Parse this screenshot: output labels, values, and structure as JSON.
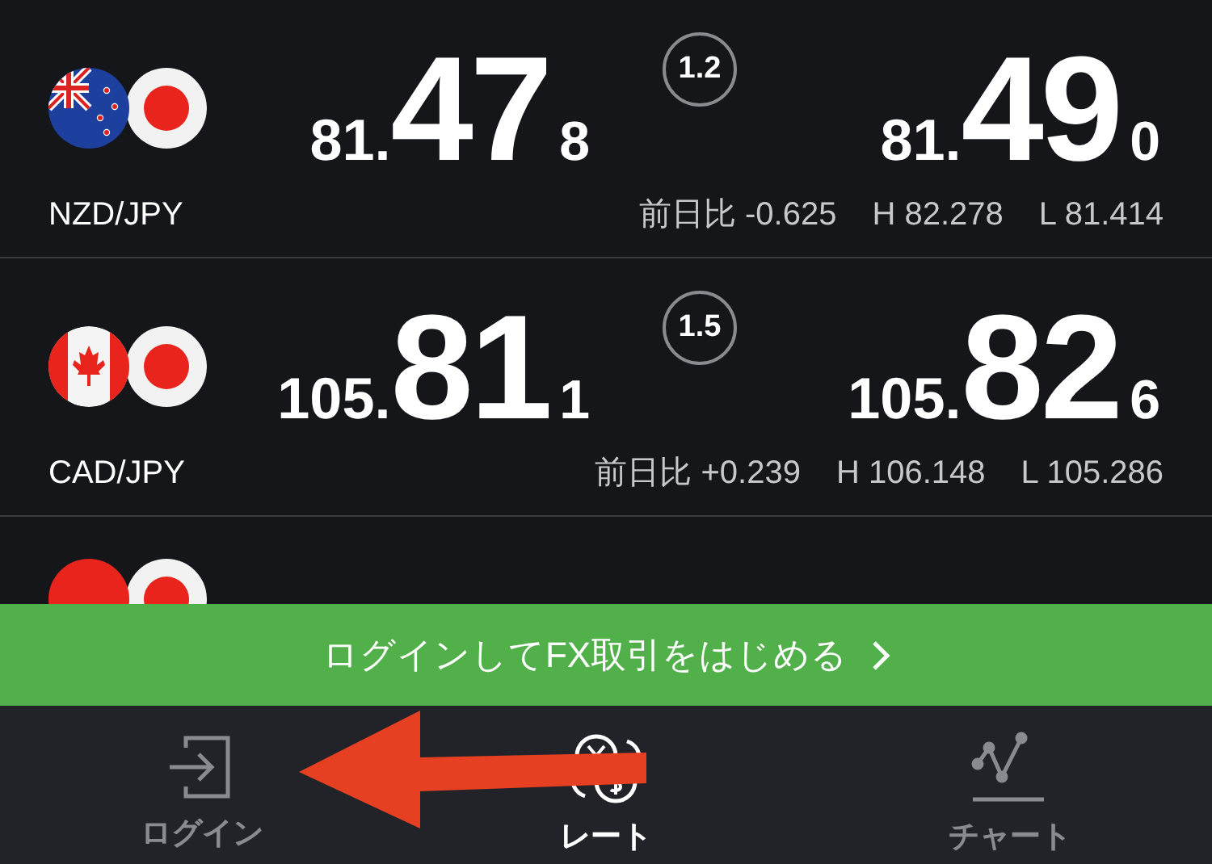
{
  "pairs": [
    {
      "name": "NZD/JPY",
      "flags": [
        {
          "kind": "nz"
        },
        {
          "kind": "jp"
        }
      ],
      "bid": {
        "head": "81.",
        "big": "47",
        "tail": "8"
      },
      "spread": "1.2",
      "ask": {
        "head": "81.",
        "big": "49",
        "tail": "0"
      },
      "change": "前日比 -0.625",
      "high": "H 82.278",
      "low": "L 81.414"
    },
    {
      "name": "CAD/JPY",
      "flags": [
        {
          "kind": "ca"
        },
        {
          "kind": "jp"
        }
      ],
      "bid": {
        "head": "105.",
        "big": "81",
        "tail": "1"
      },
      "spread": "1.5",
      "ask": {
        "head": "105.",
        "big": "82",
        "tail": "6"
      },
      "change": "前日比 +0.239",
      "high": "H 106.148",
      "low": "L 105.286"
    }
  ],
  "partial_row": {
    "flags": [
      {
        "kind": "red"
      },
      {
        "kind": "jp"
      }
    ]
  },
  "banner": {
    "text": "ログインしてFX取引をはじめる"
  },
  "tabs": [
    {
      "label": "ログイン",
      "kind": "login",
      "selected": false
    },
    {
      "label": "レート",
      "kind": "rate",
      "selected": true
    },
    {
      "label": "チャート",
      "kind": "chart",
      "selected": false
    }
  ]
}
